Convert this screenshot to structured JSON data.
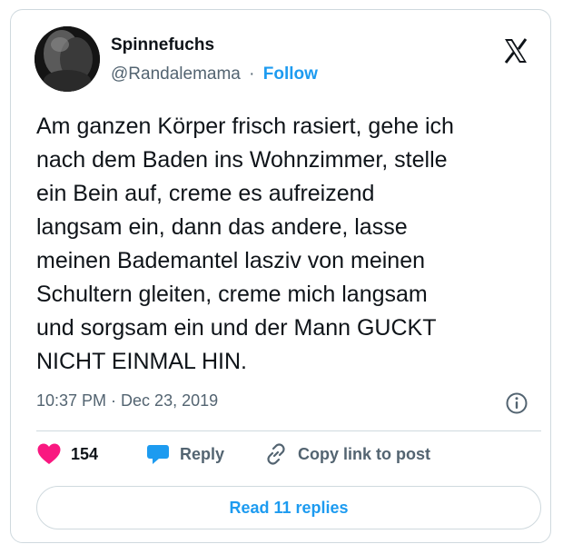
{
  "author": {
    "display_name": "Spinnefuchs",
    "handle": "@Randalemama",
    "separator": "·",
    "follow_label": "Follow"
  },
  "tweet": {
    "text": "Am ganzen Körper frisch rasiert, gehe ich\nnach dem Baden ins Wohnzimmer, stelle\nein Bein auf, creme es aufreizend\nlangsam ein, dann das andere, lasse\nmeinen Bademantel lasziv von meinen\nSchultern gleiten, creme mich langsam\nund sorgsam ein und der Mann GUCKT\nNICHT EINMAL HIN.",
    "timestamp": "10:37 PM · Dec 23, 2019"
  },
  "actions": {
    "like_count": "154",
    "reply_label": "Reply",
    "copy_link_label": "Copy link to post"
  },
  "read_replies_label": "Read 11 replies",
  "icons": {
    "avatar": "avatar",
    "logo": "x-logo-icon",
    "info": "info-icon",
    "like": "heart-icon",
    "reply": "speech-bubble-icon",
    "copy_link": "link-icon"
  },
  "colors": {
    "accent": "#1d9bf0",
    "like": "#f91880",
    "text": "#0f1419",
    "secondary": "#536471",
    "border": "#cfd9de"
  }
}
